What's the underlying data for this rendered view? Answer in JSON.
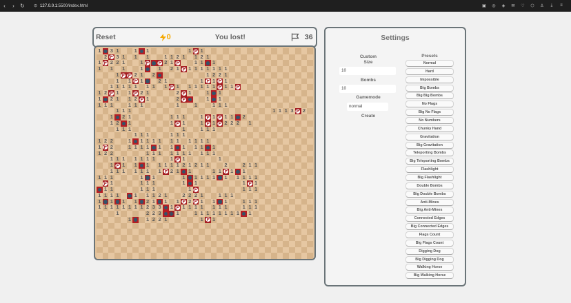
{
  "browser": {
    "url_host": "127.0.0.1",
    "url_rest": ":5500/index.html"
  },
  "header": {
    "reset": "Reset",
    "score": "0",
    "status": "You lost!",
    "flags_count": "36"
  },
  "settings": {
    "title": "Settings",
    "custom_label": "Custom",
    "size_label": "Size",
    "size_value": "10",
    "bombs_label": "Bombs",
    "bombs_value": "10",
    "gamemode_label": "Gamemode",
    "gamemode_value": "normal",
    "create_label": "Create",
    "presets_label": "Presets",
    "presets": [
      "Normal",
      "Hard",
      "Impossible",
      "Big Bombs",
      "Big Big Bombs",
      "No Flags",
      "Big No Flags",
      "No Numbers",
      "Chunky Hand",
      "Gravitation",
      "Big Gravitation",
      "Teleporting Bombs",
      "Big Teleporting Bombs",
      "Flashlight",
      "Big Flashlight",
      "Double Bombs",
      "Big Double Bombs",
      "Anti-Mines",
      "Big Anti-Mines",
      "Connected Edges",
      "Big Connected Edges",
      "Flags Count",
      "Big Flags Count",
      "Digging Dog",
      "Big Digging Dog",
      "Walking Horse",
      "Big Walking Horse"
    ]
  },
  "colors": {
    "mine": "#b51e23",
    "flag": "#a51e22",
    "tile_light": "#e6c7a2",
    "tile_dark": "#d6b48b",
    "score": "#f5a800"
  },
  "board": {
    "cols": 36,
    "rows": 35,
    "legend": "digit=number, F=flag, M=mine, X=wrong flag, .=covered tile, 0=empty revealed",
    "grid": [
      "1M31..1M1......1F1..................",
      "02F31.1.1..1121.121.................",
      "1F221..1FMF21F..11M1................",
      "10101..1M.1021F1111111..............",
      "...1FF2102M.......1221..............",
      "...101F1M.21.....1F1F1..............",
      "..1111101101F1011111F11F............",
      "12F1.1F21....2F1..1M1...............",
      "1M21.12F1....2FM..1M1...............",
      "111..111.....1001..111..............",
      "...111.......................1113F2.",
      "..1M21......111..1F1F11M2...........",
      "..12M1......1F1..1F1F222.1..........",
      "...111......001..111................",
      "......111...111.....................",
      "122..1M1111.1101111.................",
      "1F2..1111M1.1M1011M1................",
      "122.....111.1111.111................",
      "..111.1111..1F1..0001...............",
      "..1F1.1M1.11112121100200211.........",
      "..111.111.1F21M1...11F1M1...........",
      "111....1M1....1M1111M101111.........",
      "0F1....111....1M1..000..1F1.........",
      "M11....111.....1F0......111.........",
      "11110M1.1121..2221..111.............",
      "1M1M1.1M21M1.1F2F1.1M1..111.........",
      "11111111233M1F1111.111..111.........",
      "...1....223MX1..11111111M1..........",
      ".....1M.1221.....1F1...............",
      "....................................",
      "....................................",
      "....................................",
      "....................................",
      "....................................",
      "...................................."
    ]
  }
}
